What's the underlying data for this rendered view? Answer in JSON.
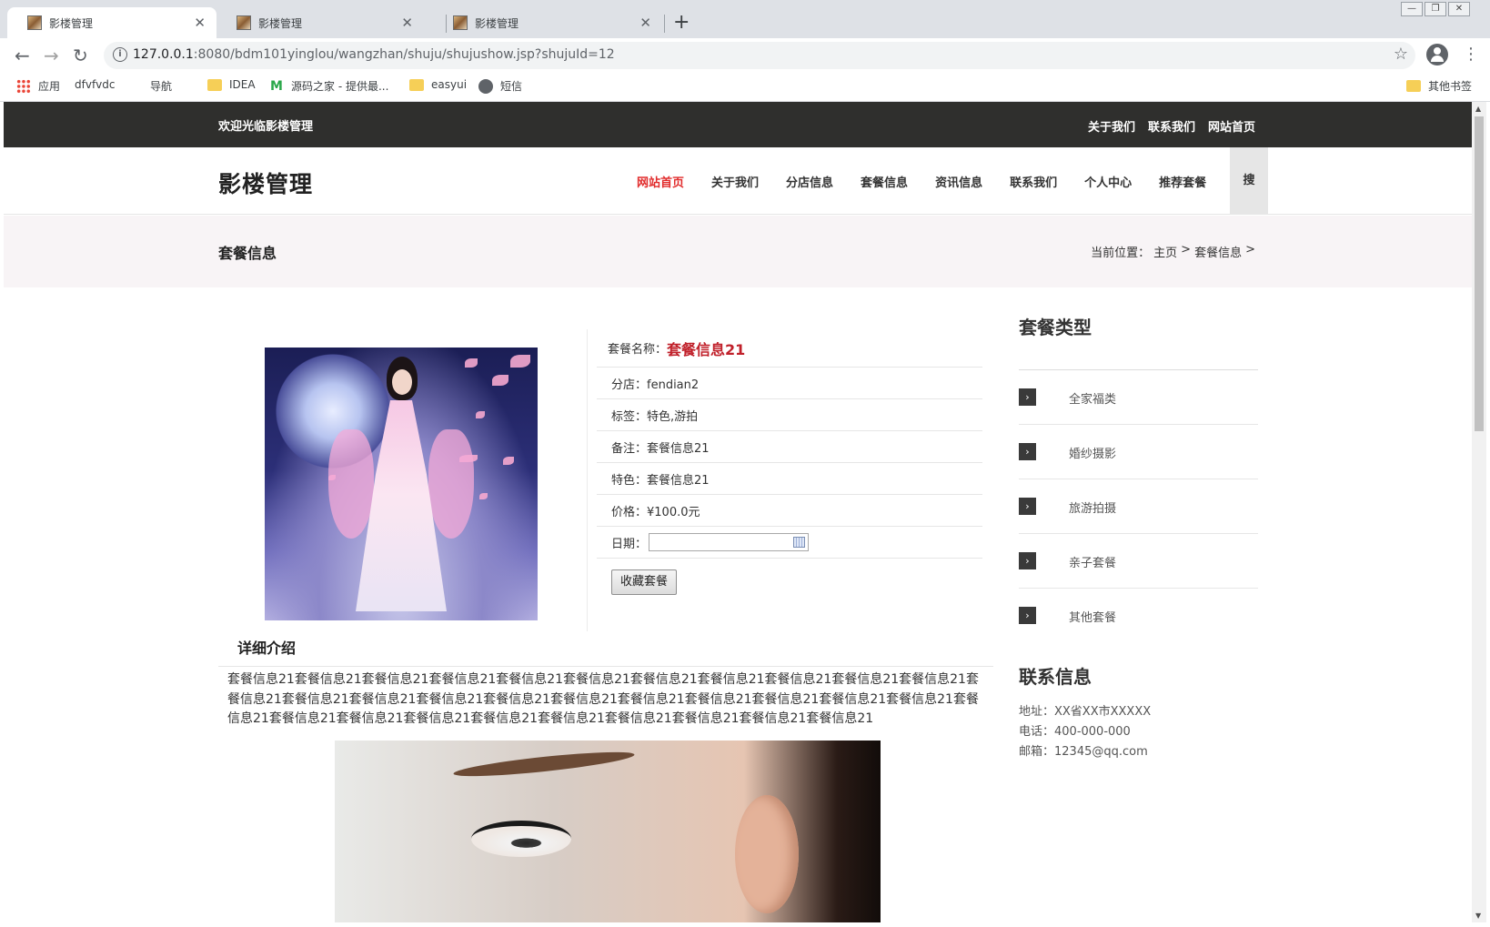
{
  "browser": {
    "tabs": [
      {
        "title": "影楼管理",
        "close": "✕"
      },
      {
        "title": "影楼管理",
        "close": "✕"
      },
      {
        "title": "影楼管理",
        "close": "✕"
      }
    ],
    "new_tab": "+",
    "url_host": "127.0.0.1",
    "url_rest": ":8080/bdm101yinglou/wangzhan/shuju/shujushow.jsp?shujuId=12",
    "bookmarks": [
      {
        "label": "应用",
        "icon": "apps-grid-icon"
      },
      {
        "label": "dfvfvdc",
        "icon": "page-icon"
      },
      {
        "label": "导航",
        "icon": "page-icon"
      },
      {
        "label": "IDEA",
        "icon": "folder-icon"
      },
      {
        "label": "源码之家 - 提供最...",
        "icon": "m-logo-icon"
      },
      {
        "label": "easyui",
        "icon": "folder-icon"
      },
      {
        "label": "短信",
        "icon": "globe-icon"
      }
    ],
    "other_bookmarks": "其他书签"
  },
  "site": {
    "welcome": "欢迎光临影楼管理",
    "top_links": [
      "关于我们",
      "联系我们",
      "网站首页"
    ],
    "logo": "影楼管理",
    "nav": [
      "网站首页",
      "关于我们",
      "分店信息",
      "套餐信息",
      "资讯信息",
      "联系我们",
      "个人中心",
      "推荐套餐"
    ],
    "nav_current": "网站首页",
    "search": "搜",
    "page_title": "套餐信息",
    "breadcrumb": {
      "prefix": "当前位置：",
      "home": "主页",
      "sep": ">",
      "current": "套餐信息",
      "tail": ">"
    }
  },
  "product": {
    "name_label": "套餐名称：",
    "name": "套餐信息21",
    "rows": [
      "分店：fendian2",
      "标签：特色,游拍",
      "备注：套餐信息21",
      "特色：套餐信息21",
      "价格：¥100.0元"
    ],
    "date_label": "日期：",
    "date_value": "",
    "favorite_button": "收藏套餐"
  },
  "detail": {
    "title": "详细介绍",
    "text": "套餐信息21套餐信息21套餐信息21套餐信息21套餐信息21套餐信息21套餐信息21套餐信息21套餐信息21套餐信息21套餐信息21套餐信息21套餐信息21套餐信息21套餐信息21套餐信息21套餐信息21套餐信息21套餐信息21套餐信息21套餐信息21套餐信息21套餐信息21套餐信息21套餐信息21套餐信息21套餐信息21套餐信息21套餐信息21套餐信息21套餐信息21套餐信息21"
  },
  "sidebar": {
    "types_title": "套餐类型",
    "types": [
      "全家福类",
      "婚纱摄影",
      "旅游拍摄",
      "亲子套餐",
      "其他套餐"
    ],
    "contact_title": "联系信息",
    "contact": [
      "地址：XX省XX市XXXXX",
      "电话：400-000-000",
      "邮箱：12345@qq.com"
    ]
  },
  "colors": {
    "accent": "#e12b2b",
    "topbar": "#2f2f2d",
    "banner": "#f8f4f6",
    "price_name": "#c0202a"
  }
}
